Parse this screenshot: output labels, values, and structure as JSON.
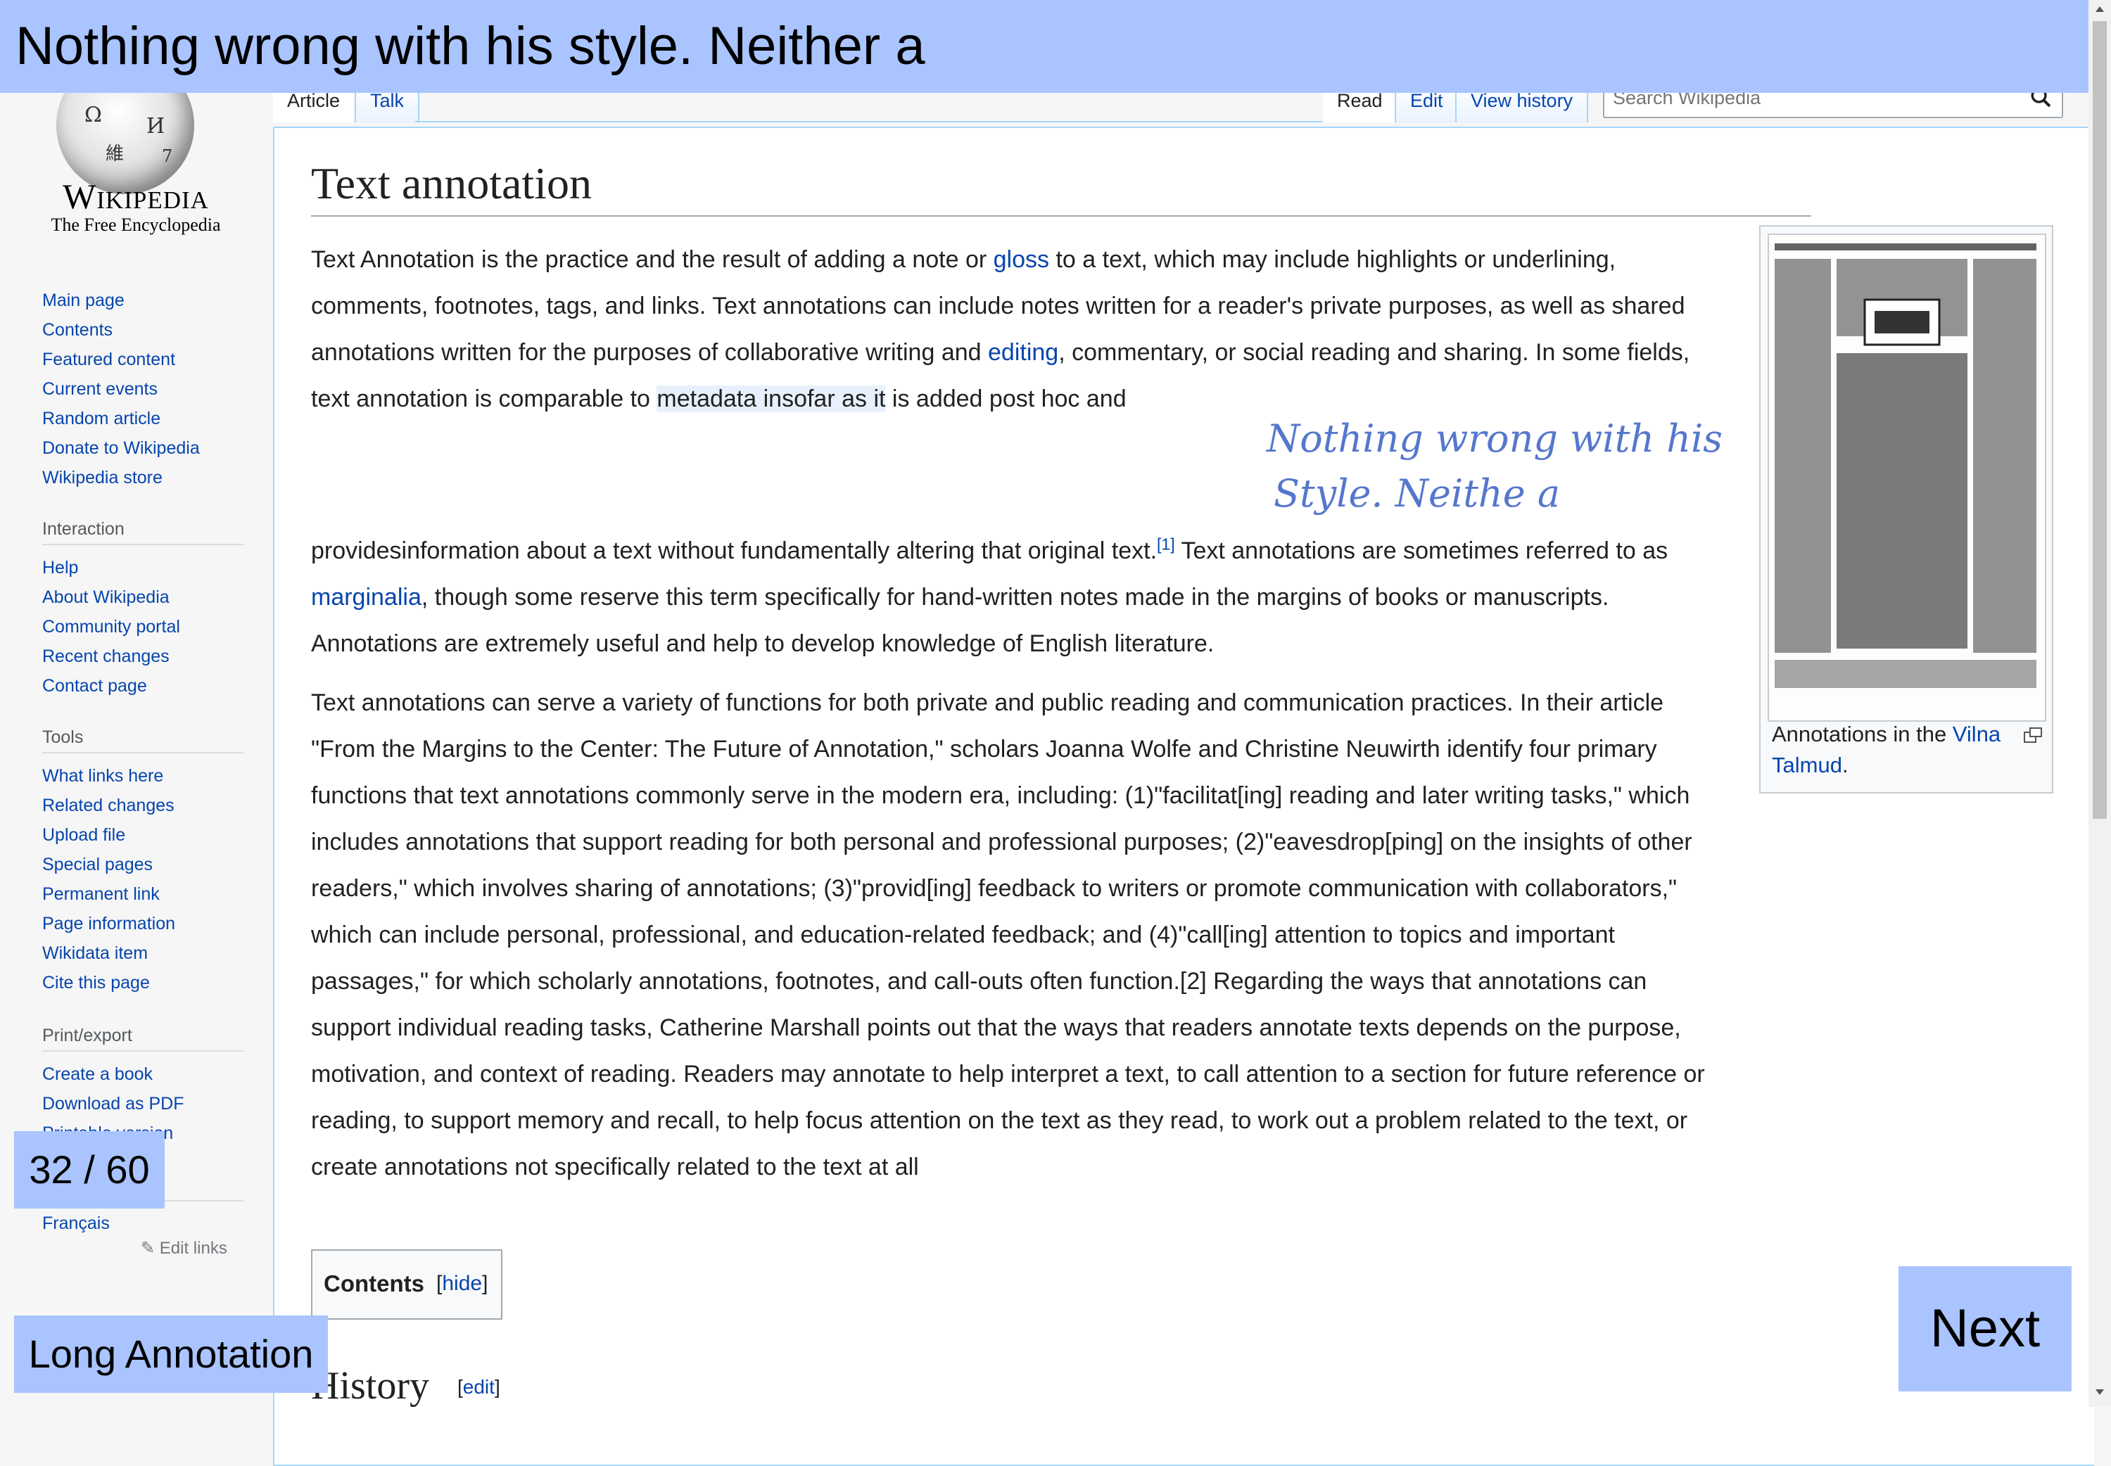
{
  "banner": {
    "text": "Nothing wrong with his style. Neither a"
  },
  "logo": {
    "name": "Wikipedia",
    "tagline": "The Free Encyclopedia"
  },
  "sidebar": {
    "navigation": [
      "Main page",
      "Contents",
      "Featured content",
      "Current events",
      "Random article",
      "Donate to Wikipedia",
      "Wikipedia store"
    ],
    "interaction_heading": "Interaction",
    "interaction": [
      "Help",
      "About Wikipedia",
      "Community portal",
      "Recent changes",
      "Contact page"
    ],
    "tools_heading": "Tools",
    "tools": [
      "What links here",
      "Related changes",
      "Upload file",
      "Special pages",
      "Permanent link",
      "Page information",
      "Wikidata item",
      "Cite this page"
    ],
    "print_heading": "Print/export",
    "print": [
      "Create a book",
      "Download as PDF",
      "Printable version"
    ],
    "languages": [
      "Français"
    ],
    "edit_links": "Edit links"
  },
  "tabs": {
    "article": "Article",
    "talk": "Talk",
    "read": "Read",
    "edit": "Edit",
    "history": "View history"
  },
  "search": {
    "placeholder": "Search Wikipedia"
  },
  "article": {
    "title": "Text annotation",
    "p1": {
      "a": "Text Annotation is the practice and the result of adding a note or ",
      "link_gloss": "gloss",
      "b": " to a text, which may include highlights or underlining, comments, footnotes, tags, and links. Text annotations can include notes written for a reader's private purposes, as well as shared annotations written for the purposes of collaborative writing and ",
      "link_editing": "editing",
      "c": ", commentary, or social reading and sharing. In some fields, text annotation is comparable to ",
      "highlight": "metadata insofar as it",
      "d": " is added post hoc and"
    },
    "p1b": {
      "a": "providesinformation about a text without fundamentally altering that original text.",
      "ref": "[1]",
      "b": " Text annotations are sometimes referred to as ",
      "link_marginalia": "marginalia",
      "c": ", though some reserve this term specifically for hand-written notes made in the margins of books or manuscripts. Annotations are extremely useful and help to develop knowledge of English literature."
    },
    "p2": "Text annotations can serve a variety of functions for both private and public reading and communication practices. In their article \"From the Margins to the Center: The Future of Annotation,\" scholars Joanna Wolfe and Christine Neuwirth identify four primary functions that text annotations commonly serve in the modern era, including: (1)\"facilitat[ing] reading and later writing tasks,\" which includes annotations that support reading for both personal and professional purposes; (2)\"eavesdrop[ping] on the insights of other readers,\" which involves sharing of annotations; (3)\"provid[ing] feedback to writers or promote communication with collaborators,\" which can include personal, professional, and education-related feedback; and (4)\"call[ing] attention to topics and important passages,\" for which scholarly annotations, footnotes, and call-outs often function.[2] Regarding the ways that annotations can support individual reading tasks, Catherine Marshall points out that the ways that readers annotate texts depends on the purpose, motivation, and context of reading. Readers may annotate to help interpret a text, to call attention to a section for future reference or reading, to support memory and recall, to help focus attention on the text as they read, to work out a problem related to the text, or create annotations not specifically related to the text at all",
    "thumb_caption_a": "Annotations in the ",
    "thumb_caption_link": "Vilna Talmud",
    "thumb_caption_b": ".",
    "toc_title": "Contents",
    "toc_hide": "hide",
    "history_heading": "History",
    "history_edit": "edit"
  },
  "handwritten_note": {
    "line1": "Nothing wrong with his",
    "line2": "Style. Neithe a"
  },
  "pager": {
    "counter": "32 / 60",
    "long_annotation": "Long Annotation",
    "next": "Next"
  }
}
